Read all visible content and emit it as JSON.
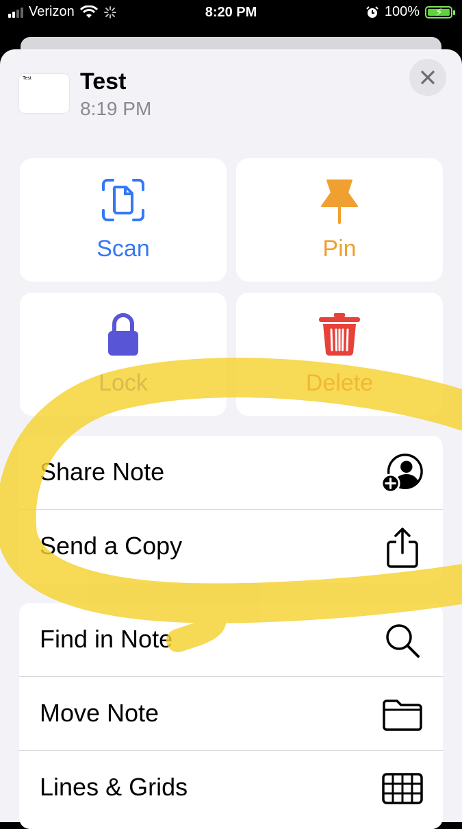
{
  "status_bar": {
    "carrier": "Verizon",
    "time": "8:20 PM",
    "battery": "100%",
    "battery_level": 1.0
  },
  "note": {
    "thumbnail_text": "Test",
    "title": "Test",
    "time": "8:19 PM"
  },
  "actions": [
    {
      "label": "Scan",
      "color": "#3478f6",
      "icon": "scan-document-icon"
    },
    {
      "label": "Pin",
      "color": "#f0a030",
      "icon": "pin-icon"
    },
    {
      "label": "Lock",
      "color": "#5856d6",
      "icon": "lock-icon"
    },
    {
      "label": "Delete",
      "color": "#e8413a",
      "icon": "trash-icon"
    }
  ],
  "share_group": [
    {
      "label": "Share Note",
      "icon": "add-person-icon"
    },
    {
      "label": "Send a Copy",
      "icon": "share-icon"
    }
  ],
  "menu_group": [
    {
      "label": "Find in Note",
      "icon": "search-icon"
    },
    {
      "label": "Move Note",
      "icon": "folder-icon"
    },
    {
      "label": "Lines & Grids",
      "icon": "grid-icon"
    }
  ],
  "colors": {
    "highlighter": "#f5d230",
    "sheet_background": "#f2f2f7"
  }
}
